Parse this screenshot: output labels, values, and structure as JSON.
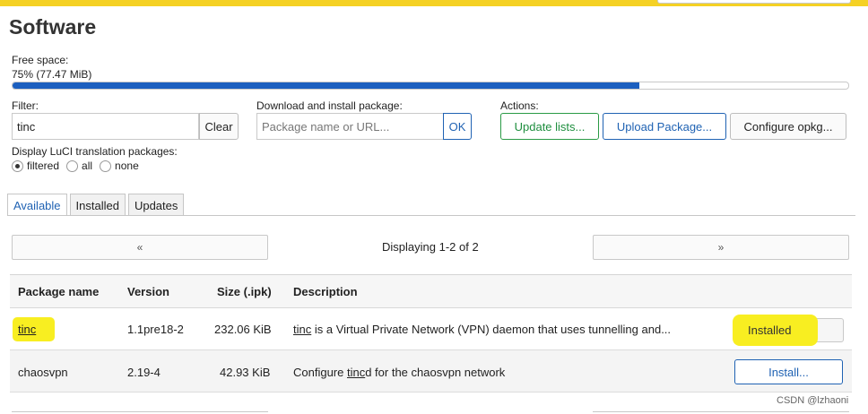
{
  "page_title": "Software",
  "free_space": {
    "label": "Free space:",
    "value": "75% (77.47 MiB)",
    "percent_used": 75
  },
  "filter": {
    "label": "Filter:",
    "value": "tinc",
    "clear_label": "Clear"
  },
  "download": {
    "label": "Download and install package:",
    "placeholder": "Package name or URL...",
    "ok_label": "OK"
  },
  "actions": {
    "label": "Actions:",
    "update_lists": "Update lists...",
    "upload_package": "Upload Package...",
    "configure_opkg": "Configure opkg..."
  },
  "translation": {
    "label": "Display LuCI translation packages:",
    "options": [
      "filtered",
      "all",
      "none"
    ],
    "selected": "filtered"
  },
  "tabs": [
    "Available",
    "Installed",
    "Updates"
  ],
  "pager": {
    "prev": "«",
    "next": "»",
    "status": "Displaying 1-2 of 2"
  },
  "table": {
    "headers": [
      "Package name",
      "Version",
      "Size (.ipk)",
      "Description"
    ],
    "rows": [
      {
        "name": "tinc",
        "version": "1.1pre18-2",
        "size": "232.06 KiB",
        "desc_link": "tinc",
        "desc_rest": " is a Virtual Private Network (VPN) daemon that uses tunnelling and...",
        "action": "Installed"
      },
      {
        "name": "chaosvpn",
        "version": "2.19-4",
        "size": "42.93 KiB",
        "desc_pre": "Configure ",
        "desc_link": "tinc",
        "desc_post": "d for the chaosvpn network",
        "action": "Install..."
      }
    ]
  },
  "watermark": "CSDN @lzhaoni",
  "colors": {
    "accent_blue": "#1f62b3",
    "progress_blue": "#1c5fbf",
    "update_green": "#1e8e3e",
    "highlight_yellow": "#f8ee21",
    "topbar_yellow": "#f5d124"
  }
}
